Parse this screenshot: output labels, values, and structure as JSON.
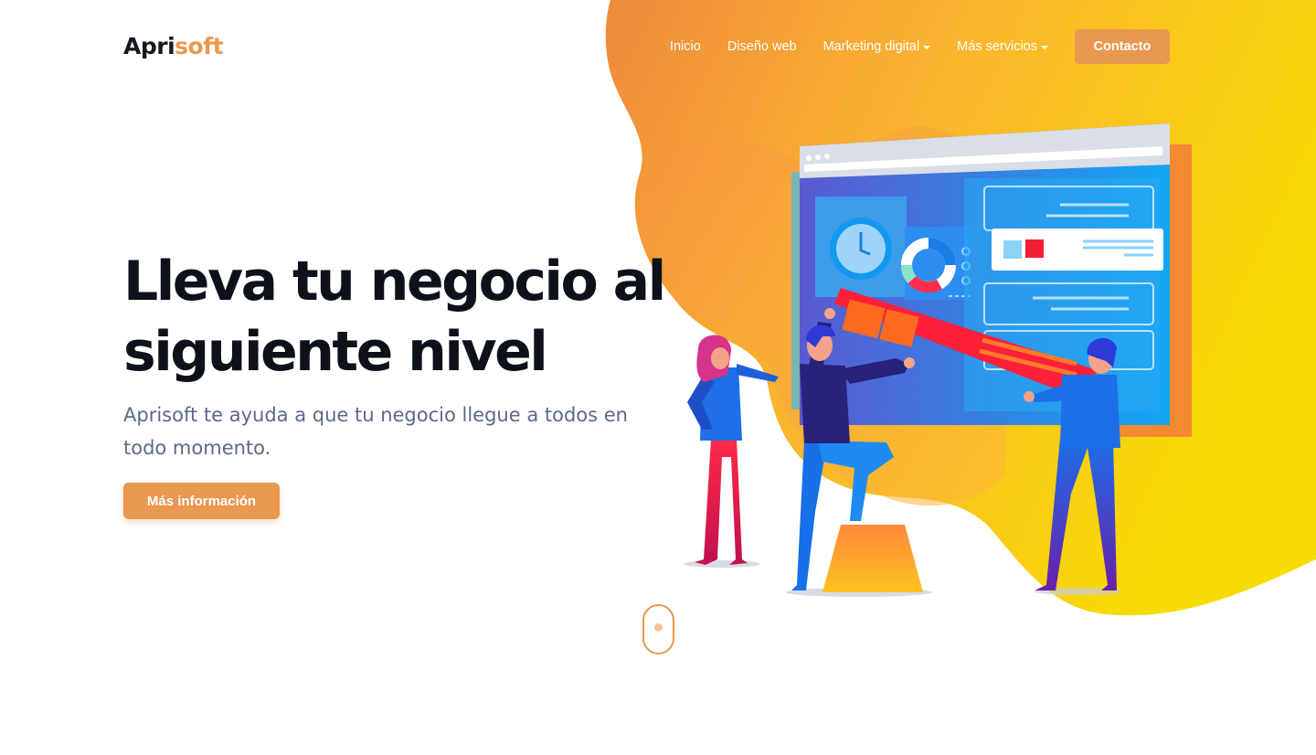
{
  "brand": {
    "part1": "Apri",
    "part2": "soft"
  },
  "nav": {
    "items": [
      {
        "label": "Inicio",
        "dropdown": false
      },
      {
        "label": "Diseño web",
        "dropdown": false
      },
      {
        "label": "Marketing digital",
        "dropdown": true
      },
      {
        "label": "Más servicios",
        "dropdown": true
      }
    ],
    "cta_label": "Contacto"
  },
  "hero": {
    "title": "Lleva tu negocio al siguiente nivel",
    "subtitle": "Aprisoft te ayuda a que tu negocio llegue a todos en todo momento.",
    "button_label": "Más información",
    "illustration_icon": "team-building-website-illustration"
  },
  "scroll_indicator": {
    "icon": "mouse-scroll-icon"
  },
  "colors": {
    "accent": "#e9984f",
    "heading": "#0c111a",
    "body_text": "#5a6a86",
    "blob_orange": "#f3923b",
    "blob_yellow": "#f7d803"
  }
}
